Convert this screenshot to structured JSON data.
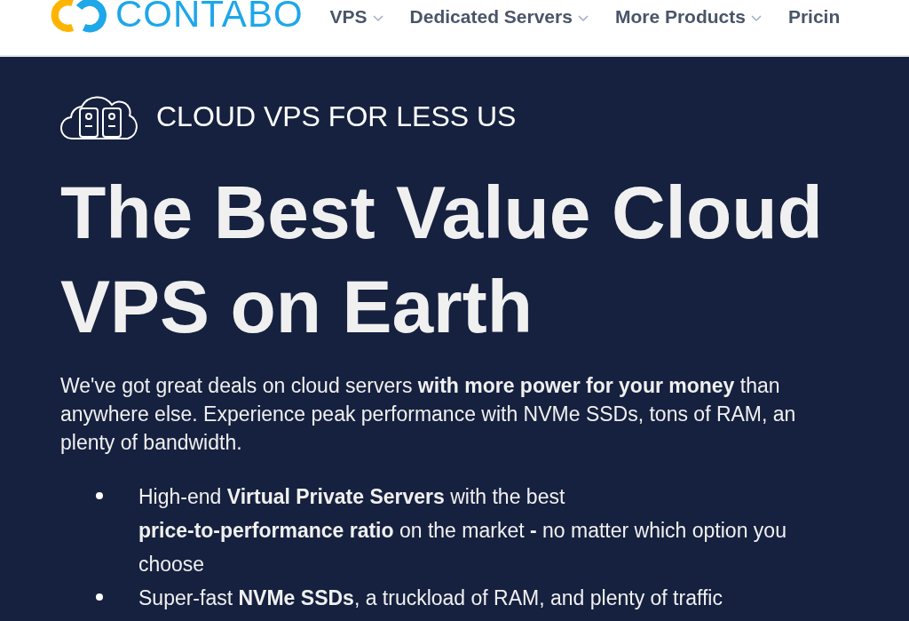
{
  "header": {
    "logo": "CONTABO",
    "nav": [
      {
        "label": "VPS",
        "dropdown": true
      },
      {
        "label": "Dedicated Servers",
        "dropdown": true
      },
      {
        "label": "More Products",
        "dropdown": true
      },
      {
        "label": "Pricin",
        "dropdown": false
      }
    ]
  },
  "hero": {
    "eyebrow": "CLOUD VPS FOR LESS US",
    "title": "The Best Value Cloud\nVPS on Earth",
    "intro": "We've got great deals on cloud servers **with more power for your money** than\nanywhere else. Experience peak performance with NVMe SSDs, tons of RAM, an\nplenty of bandwidth.",
    "bullets": [
      "High-end **Virtual Private Servers** with the best\n**price-to-performance ratio** on the market **-** no matter which option you\nchoose",
      "Super-fast **NVMe SSDs**, a truckload of RAM, and plenty of traffic"
    ]
  }
}
